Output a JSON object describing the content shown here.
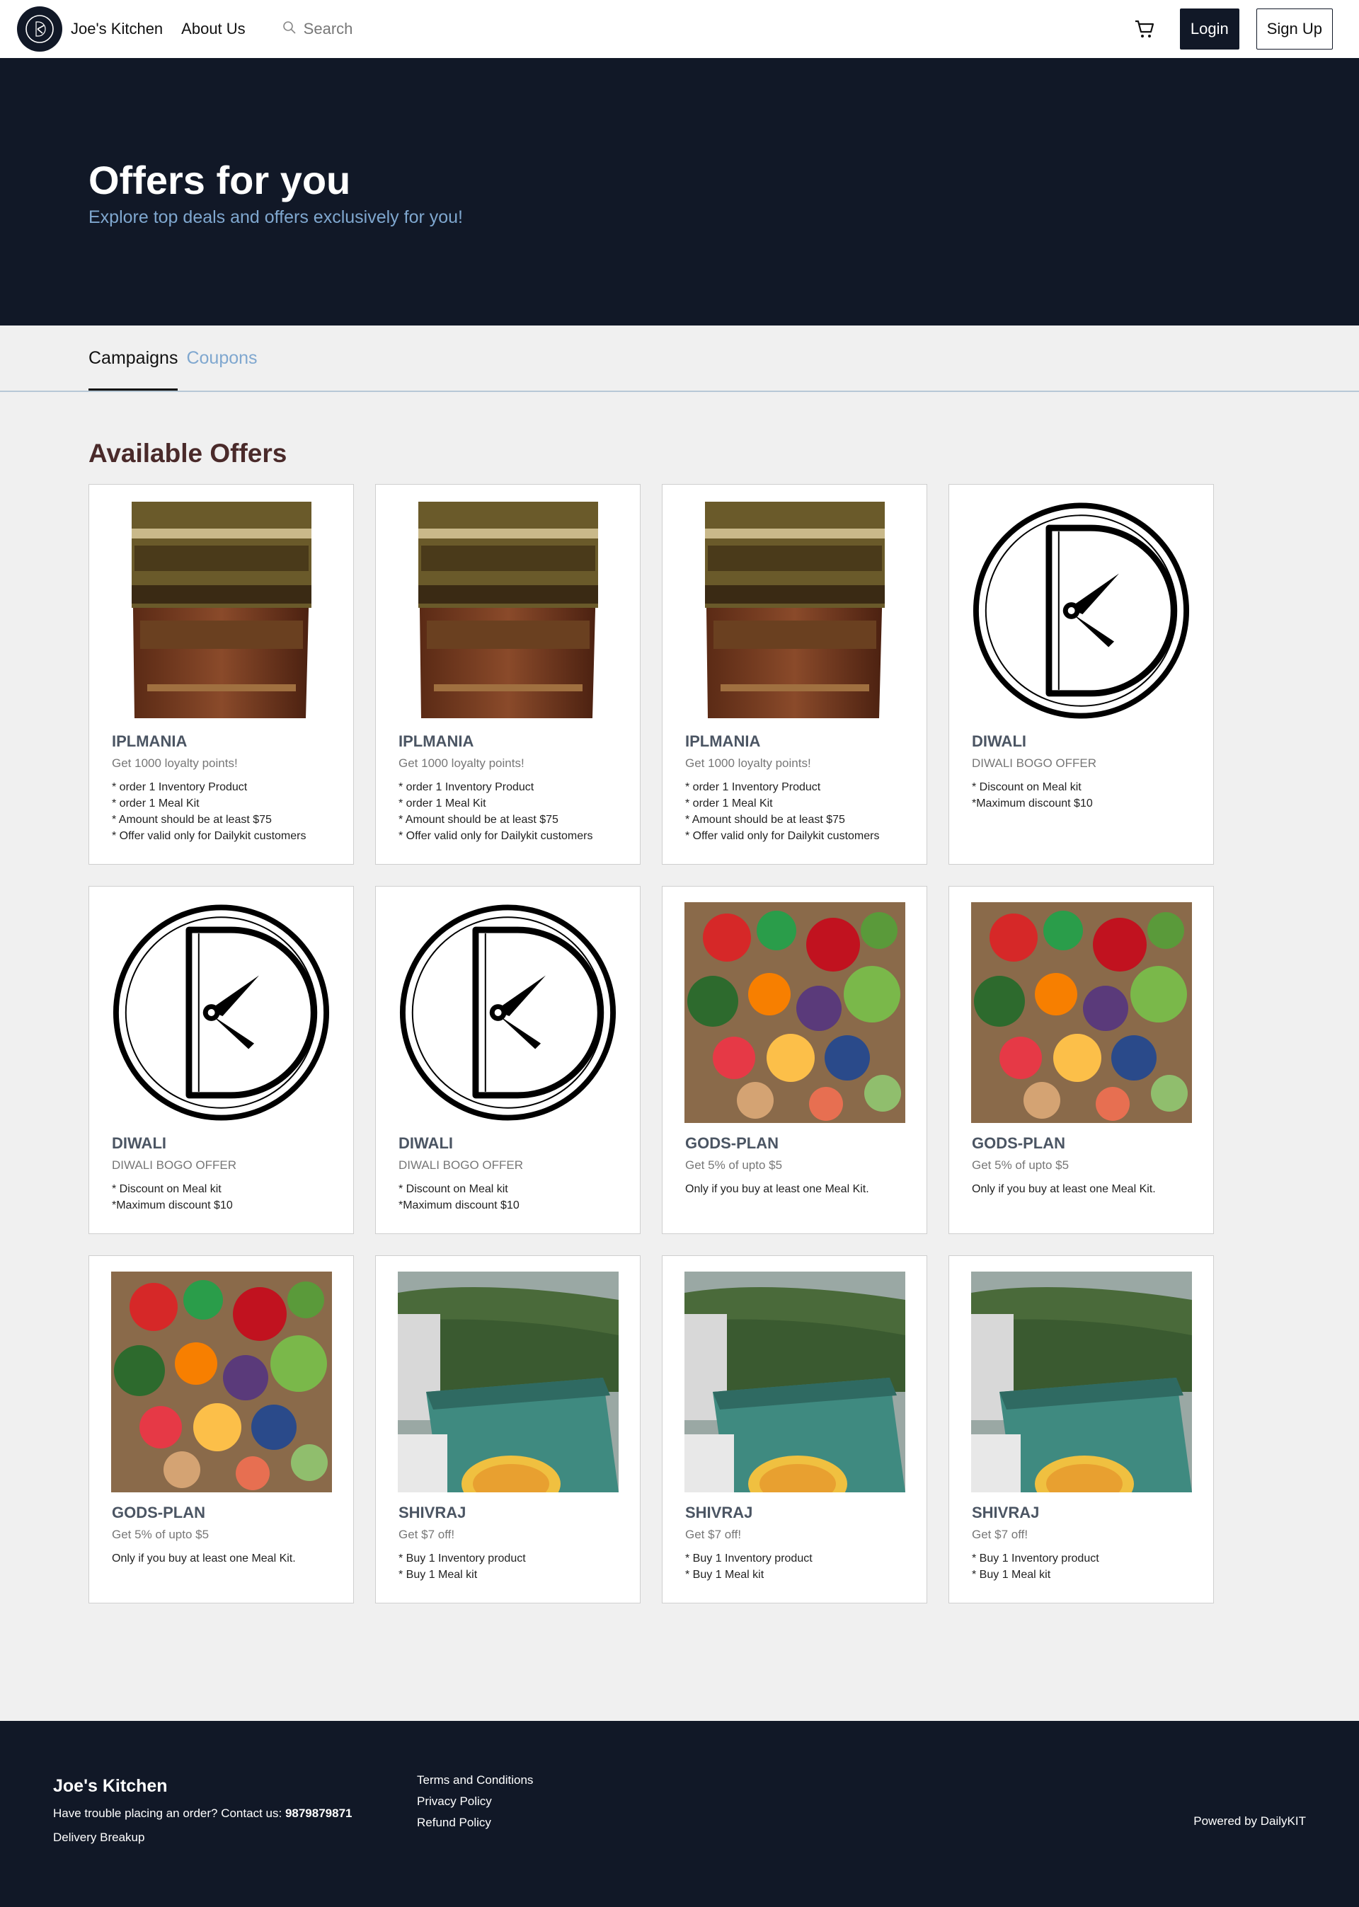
{
  "header": {
    "brand_name": "Joe's Kitchen",
    "about_label": "About Us",
    "search_placeholder": "Search",
    "login_label": "Login",
    "signup_label": "Sign Up"
  },
  "hero": {
    "title": "Offers for you",
    "subtitle": "Explore top deals and offers exclusively for you!"
  },
  "tabs": [
    {
      "label": "Campaigns",
      "active": true
    },
    {
      "label": "Coupons",
      "active": false
    }
  ],
  "offers": {
    "section_title": "Available Offers",
    "cards": [
      {
        "image": "potato-chips-bag",
        "title": "IPLMANIA",
        "desc": "Get 1000 loyalty points!",
        "rules": "* order 1 Inventory Product\n* order 1 Meal Kit\n* Amount should be at least $75\n* Offer valid only for Dailykit customers"
      },
      {
        "image": "potato-chips-bag",
        "title": "IPLMANIA",
        "desc": "Get 1000 loyalty points!",
        "rules": "* order 1 Inventory Product\n* order 1 Meal Kit\n* Amount should be at least $75\n* Offer valid only for Dailykit customers"
      },
      {
        "image": "potato-chips-bag",
        "title": "IPLMANIA",
        "desc": "Get 1000 loyalty points!",
        "rules": "* order 1 Inventory Product\n* order 1 Meal Kit\n* Amount should be at least $75\n* Offer valid only for Dailykit customers"
      },
      {
        "image": "dailykit-logo",
        "title": "DIWALI",
        "desc": "DIWALI BOGO OFFER",
        "rules": "* Discount on Meal kit\n*Maximum discount $10"
      },
      {
        "image": "dailykit-logo",
        "title": "DIWALI",
        "desc": "DIWALI BOGO OFFER",
        "rules": "* Discount on Meal kit\n*Maximum discount $10"
      },
      {
        "image": "dailykit-logo",
        "title": "DIWALI",
        "desc": "DIWALI BOGO OFFER",
        "rules": "* Discount on Meal kit\n*Maximum discount $10"
      },
      {
        "image": "vegetables-photo",
        "title": "GODS-PLAN",
        "desc": "Get 5% of upto $5",
        "rules": "Only if you buy at least one Meal Kit."
      },
      {
        "image": "vegetables-photo",
        "title": "GODS-PLAN",
        "desc": "Get 5% of upto $5",
        "rules": "Only if you buy at least one Meal Kit."
      },
      {
        "image": "vegetables-photo",
        "title": "GODS-PLAN",
        "desc": "Get 5% of upto $5",
        "rules": "Only if you buy at least one Meal Kit."
      },
      {
        "image": "hillside-food-photo",
        "title": "SHIVRAJ",
        "desc": "Get $7 off!",
        "rules": "* Buy 1 Inventory product\n* Buy 1 Meal kit"
      },
      {
        "image": "hillside-food-photo",
        "title": "SHIVRAJ",
        "desc": "Get $7 off!",
        "rules": "* Buy 1 Inventory product\n* Buy 1 Meal kit"
      },
      {
        "image": "hillside-food-photo",
        "title": "SHIVRAJ",
        "desc": "Get $7 off!",
        "rules": "* Buy 1 Inventory product\n* Buy 1 Meal kit"
      }
    ]
  },
  "footer": {
    "brand": "Joe's Kitchen",
    "contact_text": "Have trouble placing an order? Contact us:",
    "phone": "9879879871",
    "delivery": "Delivery Breakup",
    "links": [
      "Terms and Conditions",
      "Privacy Policy",
      "Refund Policy"
    ],
    "powered_by": "Powered by DailyKIT"
  },
  "colors": {
    "navy": "#111827",
    "accent_blue": "#7fa7cf",
    "section_title": "#4a2a2a"
  }
}
